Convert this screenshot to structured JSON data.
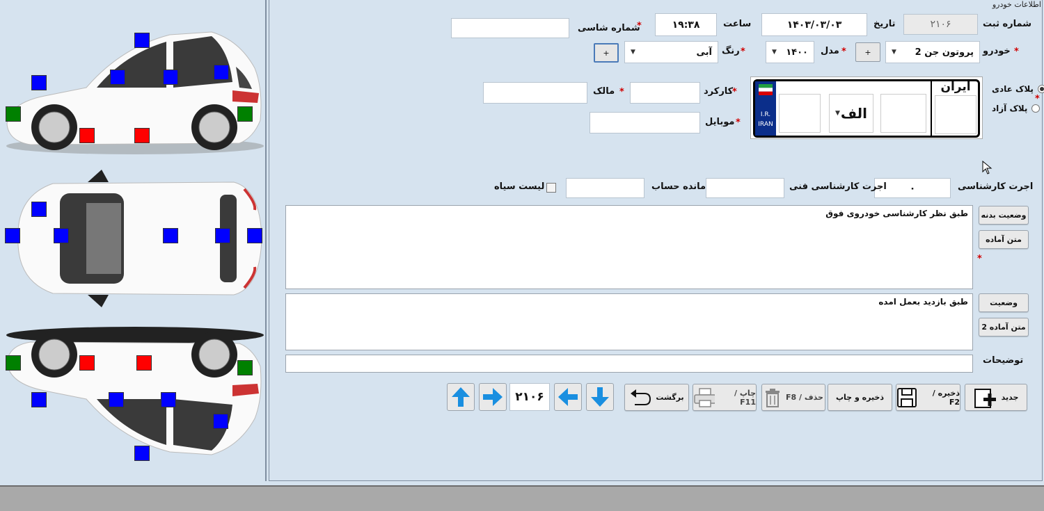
{
  "group_title": "اطلاعات خودرو",
  "fields": {
    "reg_no_label": "شماره ثبت",
    "reg_no_value": "۲۱۰۶",
    "date_label": "تاریخ",
    "date_value": "۱۴۰۳/۰۳/۰۳",
    "time_label": "ساعت",
    "time_value": "۱۹:۳۸",
    "chassis_label": "شماره شاسی",
    "chassis_value": "",
    "car_label": "خودرو",
    "car_value": "پروتون جن 2",
    "model_label": "مدل",
    "model_value": "۱۴۰۰",
    "color_label": "رنگ",
    "color_value": "آبی",
    "plus": "+",
    "mileage_label": "کارکرد",
    "owner_label": "مالک",
    "mobile_label": "موبایل",
    "inspection_fee_label": "اجرت کارشناسی",
    "inspection_fee_value": "۰",
    "tech_fee_label": "اجرت کارشناسی فنی",
    "balance_label": "مانده حساب",
    "blacklist_label": "لیست سیاه",
    "notes_label": "توضیحات"
  },
  "plate": {
    "normal_label": "پلاک عادی",
    "free_label": "پلاک آزاد",
    "iran_word": "ایران",
    "letter": "الف",
    "country_code": "I.R. IRAN"
  },
  "body_status": {
    "button": "وضعیت بدنه",
    "preset_button": "متن آماده",
    "text": "طبق نظر کارشناسی خودروی فوق"
  },
  "status": {
    "button": "وضعیت",
    "preset_button": "متن آماده 2",
    "text": "طبق بازدید بعمل امده"
  },
  "toolbar": {
    "new": "جدید",
    "save": "ذخیره / F2",
    "save_print": "ذخیره و چاپ",
    "delete": "حذف / F8",
    "print": "چاپ / F11",
    "back": "برگشت",
    "record_no": "۲۱۰۶"
  },
  "colors": {
    "panel_bg": "#d6e3ef",
    "marker_blue": "#0000ff",
    "marker_red": "#ff0000",
    "marker_green": "#008000",
    "required": "#d00000",
    "arrow_blue": "#1a8fe0"
  }
}
